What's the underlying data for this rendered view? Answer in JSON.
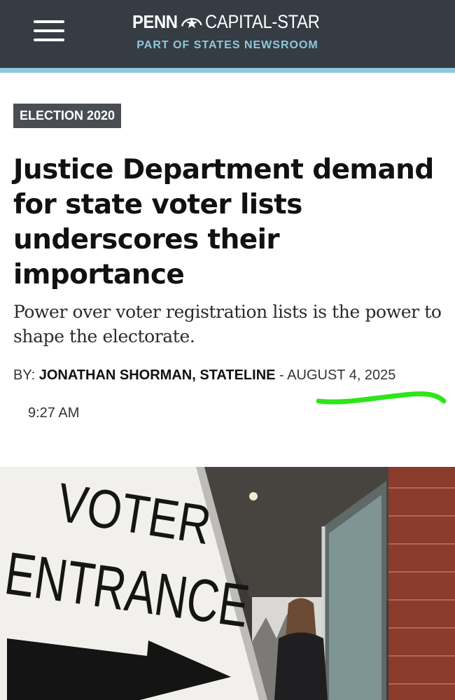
{
  "header": {
    "logo_left": "PENN",
    "logo_right": "CAPITAL-STAR",
    "tagline": "PART OF STATES NEWSROOM",
    "menu_icon": "hamburger-menu-icon",
    "logo_icon": "star-swoosh-icon",
    "bg_color": "#353c44",
    "accent_color": "#8ec8db"
  },
  "article": {
    "category": "ELECTION 2020",
    "headline": "Justice Department demand for state voter lists underscores their importance",
    "subhead": "Power over voter registration lists is the power to shape the electorate.",
    "byline_prefix": "BY: ",
    "author": "JONATHAN SHORMAN, STATELINE",
    "separator": " - ",
    "date": "AUGUST 4, 2025",
    "time": "9:27 AM",
    "highlight_color": "#2ee51a"
  },
  "photo": {
    "sign_line1": "VOTER",
    "sign_line2": "ENTRANCE",
    "arrow_icon": "right-arrow-icon"
  }
}
